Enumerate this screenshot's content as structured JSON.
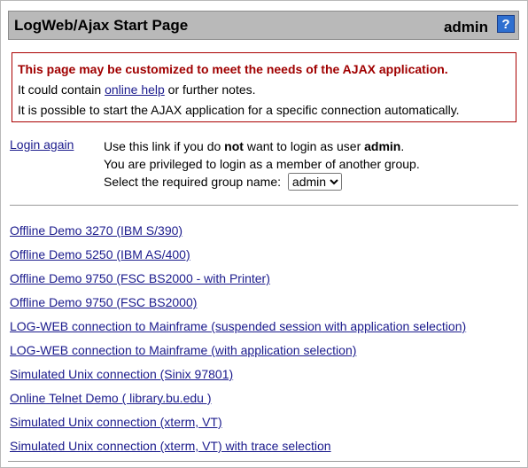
{
  "header": {
    "title": "LogWeb/Ajax Start Page",
    "user": "admin",
    "help_label": "?"
  },
  "note": {
    "headline": "This page may be customized to meet the needs of the AJAX application.",
    "line2_pre": "It could contain ",
    "line2_link": "online help",
    "line2_post": " or further notes.",
    "line3": "It is possible to start the AJAX application for a specific connection automatically."
  },
  "login": {
    "link_label": "Login again",
    "line1_pre": "Use this link if you do ",
    "line1_bold": "not",
    "line1_mid": " want to login as user ",
    "line1_user": "admin",
    "line1_end": ".",
    "line2": "You are privileged to login as a member of another group.",
    "line3": "Select the required group name:",
    "group_selected": "admin"
  },
  "connections": [
    "Offline Demo 3270 (IBM S/390)",
    "Offline Demo 5250 (IBM AS/400)",
    "Offline Demo 9750 (FSC BS2000 - with Printer)",
    "Offline Demo 9750 (FSC BS2000)",
    "LOG-WEB connection to Mainframe (suspended session with application selection)",
    "LOG-WEB connection to Mainframe (with application selection)",
    "Simulated Unix connection (Sinix 97801)",
    "Online Telnet Demo ( library.bu.edu )",
    "Simulated Unix connection (xterm, VT)",
    "Simulated Unix connection (xterm, VT) with trace selection"
  ],
  "colors": {
    "header_bg": "#b9b9b9",
    "note_border": "#aa0000",
    "note_headline": "#a00000",
    "link": "#1a1a8c",
    "help_button": "#2e6fd0"
  }
}
